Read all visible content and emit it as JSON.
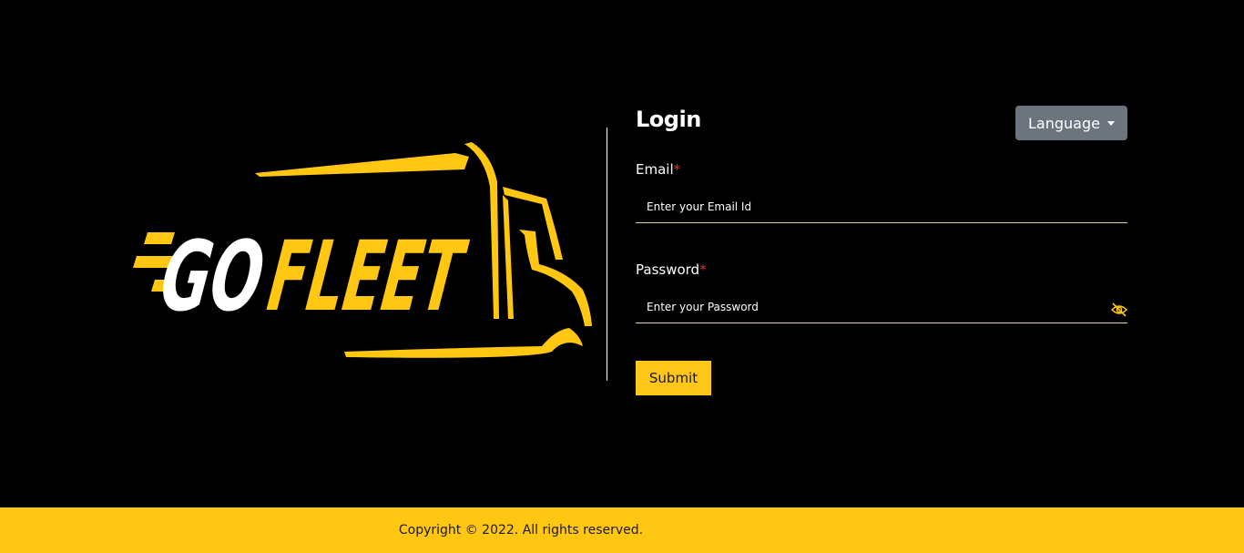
{
  "brand": {
    "logo_text_part1": "GO",
    "logo_text_part2": "FLEET",
    "accent_color": "#ffc712"
  },
  "login": {
    "title": "Login",
    "language_button": "Language",
    "email_label": "Email",
    "email_required_mark": "*",
    "email_placeholder": "Enter your Email Id",
    "password_label": "Password",
    "password_required_mark": "*",
    "password_placeholder": "Enter your Password",
    "password_toggle_icon": "eye-slash-icon",
    "submit_label": "Submit"
  },
  "footer": {
    "copyright": "Copyright © 2022. All rights reserved."
  }
}
